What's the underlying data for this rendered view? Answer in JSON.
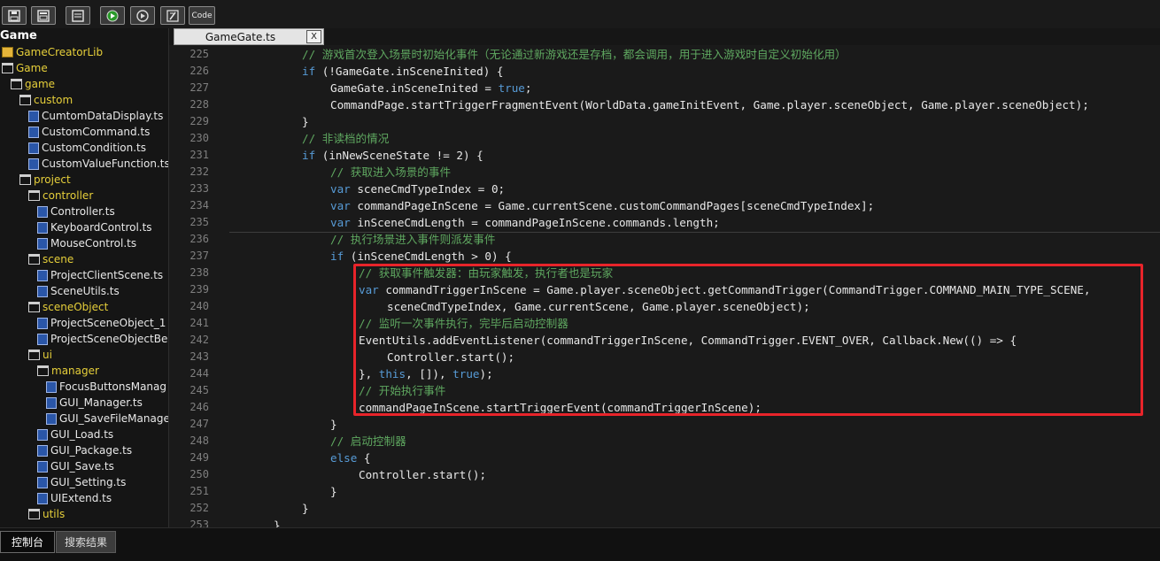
{
  "toolbar": {
    "buttons": [
      {
        "name": "save",
        "icon": "save-icon"
      },
      {
        "name": "save-all",
        "icon": "save-all-icon"
      },
      {
        "name": "layout",
        "icon": "layout-icon"
      },
      {
        "name": "run",
        "icon": "play-icon"
      },
      {
        "name": "run-debug",
        "icon": "play-outline-icon"
      },
      {
        "name": "tool",
        "icon": "tool-icon"
      }
    ],
    "code_label": "Code"
  },
  "sidebar": {
    "title": "Game",
    "items": [
      {
        "label": "GameCreatorLib",
        "type": "lib",
        "level": 0
      },
      {
        "label": "Game",
        "type": "folder",
        "level": 0
      },
      {
        "label": "game",
        "type": "folder",
        "level": 1
      },
      {
        "label": "custom",
        "type": "folder",
        "level": 2
      },
      {
        "label": "CumtomDataDisplay.ts",
        "type": "file",
        "level": 3
      },
      {
        "label": "CustomCommand.ts",
        "type": "file",
        "level": 3
      },
      {
        "label": "CustomCondition.ts",
        "type": "file",
        "level": 3
      },
      {
        "label": "CustomValueFunction.ts",
        "type": "file",
        "level": 3
      },
      {
        "label": "project",
        "type": "folder",
        "level": 2
      },
      {
        "label": "controller",
        "type": "folder",
        "level": 3
      },
      {
        "label": "Controller.ts",
        "type": "file",
        "level": 4
      },
      {
        "label": "KeyboardControl.ts",
        "type": "file",
        "level": 4
      },
      {
        "label": "MouseControl.ts",
        "type": "file",
        "level": 4
      },
      {
        "label": "scene",
        "type": "folder",
        "level": 3
      },
      {
        "label": "ProjectClientScene.ts",
        "type": "file",
        "level": 4
      },
      {
        "label": "SceneUtils.ts",
        "type": "file",
        "level": 4
      },
      {
        "label": "sceneObject",
        "type": "folder",
        "level": 3
      },
      {
        "label": "ProjectSceneObject_1",
        "type": "file",
        "level": 4
      },
      {
        "label": "ProjectSceneObjectBe",
        "type": "file",
        "level": 4
      },
      {
        "label": "ui",
        "type": "folder",
        "level": 3
      },
      {
        "label": "manager",
        "type": "folder",
        "level": 4
      },
      {
        "label": "FocusButtonsManag",
        "type": "file",
        "level": 5
      },
      {
        "label": "GUI_Manager.ts",
        "type": "file",
        "level": 5
      },
      {
        "label": "GUI_SaveFileManage",
        "type": "file",
        "level": 5
      },
      {
        "label": "GUI_Load.ts",
        "type": "file",
        "level": 4
      },
      {
        "label": "GUI_Package.ts",
        "type": "file",
        "level": 4
      },
      {
        "label": "GUI_Save.ts",
        "type": "file",
        "level": 4
      },
      {
        "label": "GUI_Setting.ts",
        "type": "file",
        "level": 4
      },
      {
        "label": "UIExtend.ts",
        "type": "file",
        "level": 4
      },
      {
        "label": "utils",
        "type": "folder",
        "level": 3
      }
    ]
  },
  "tab": {
    "label": "GameGate.ts",
    "close": "X"
  },
  "editor": {
    "lines": [
      {
        "num": "225",
        "indent": 2,
        "segments": [
          {
            "t": "// 游戏首次登入场景时初始化事件（无论通过新游戏还是存档，都会调用，用于进入游戏时自定义初始化用）",
            "c": "cmt"
          }
        ]
      },
      {
        "num": "226",
        "indent": 2,
        "segments": [
          {
            "t": "if",
            "c": "kw"
          },
          {
            "t": " (!GameGate.inSceneInited) {",
            "c": ""
          }
        ]
      },
      {
        "num": "227",
        "indent": 3,
        "segments": [
          {
            "t": "GameGate.inSceneInited = ",
            "c": ""
          },
          {
            "t": "true",
            "c": "kw"
          },
          {
            "t": ";",
            "c": ""
          }
        ]
      },
      {
        "num": "228",
        "indent": 3,
        "segments": [
          {
            "t": "CommandPage.startTriggerFragmentEvent(WorldData.gameInitEvent, Game.player.sceneObject, Game.player.sceneObject);",
            "c": ""
          }
        ]
      },
      {
        "num": "229",
        "indent": 2,
        "segments": [
          {
            "t": "}",
            "c": ""
          }
        ]
      },
      {
        "num": "230",
        "indent": 2,
        "segments": [
          {
            "t": "// 非读档的情况",
            "c": "cmt"
          }
        ]
      },
      {
        "num": "231",
        "indent": 2,
        "segments": [
          {
            "t": "if",
            "c": "kw"
          },
          {
            "t": " (inNewSceneState != 2) {",
            "c": ""
          }
        ]
      },
      {
        "num": "232",
        "indent": 3,
        "segments": [
          {
            "t": "// 获取进入场景的事件",
            "c": "cmt"
          }
        ]
      },
      {
        "num": "233",
        "indent": 3,
        "segments": [
          {
            "t": "var",
            "c": "kw"
          },
          {
            "t": " sceneCmdTypeIndex = 0;",
            "c": ""
          }
        ]
      },
      {
        "num": "234",
        "indent": 3,
        "segments": [
          {
            "t": "var",
            "c": "kw"
          },
          {
            "t": " commandPageInScene = Game.currentScene.customCommandPages[sceneCmdTypeIndex];",
            "c": ""
          }
        ]
      },
      {
        "num": "235",
        "indent": 3,
        "segments": [
          {
            "t": "var",
            "c": "kw"
          },
          {
            "t": " inSceneCmdLength = commandPageInScene.commands.length;",
            "c": ""
          }
        ]
      },
      {
        "num": "236",
        "indent": 3,
        "segments": [
          {
            "t": "// 执行场景进入事件则派发事件",
            "c": "cmt"
          }
        ]
      },
      {
        "num": "237",
        "indent": 3,
        "segments": [
          {
            "t": "if",
            "c": "kw"
          },
          {
            "t": " (inSceneCmdLength > 0) {",
            "c": ""
          }
        ]
      },
      {
        "num": "238",
        "indent": 4,
        "segments": [
          {
            "t": "// 获取事件触发器：由玩家触发，执行者也是玩家",
            "c": "cmt"
          }
        ]
      },
      {
        "num": "239",
        "indent": 4,
        "segments": [
          {
            "t": "var",
            "c": "kw"
          },
          {
            "t": " commandTriggerInScene = Game.player.sceneObject.getCommandTrigger(CommandTrigger.COMMAND_MAIN_TYPE_SCENE,",
            "c": ""
          }
        ]
      },
      {
        "num": "240",
        "indent": 5,
        "segments": [
          {
            "t": "sceneCmdTypeIndex, Game.currentScene, Game.player.sceneObject);",
            "c": ""
          }
        ]
      },
      {
        "num": "241",
        "indent": 4,
        "segments": [
          {
            "t": "// 监听一次事件执行，完毕后启动控制器",
            "c": "cmt"
          }
        ]
      },
      {
        "num": "242",
        "indent": 4,
        "segments": [
          {
            "t": "EventUtils.addEventListener(commandTriggerInScene, CommandTrigger.EVENT_OVER, Callback.New(() => {",
            "c": ""
          }
        ]
      },
      {
        "num": "243",
        "indent": 5,
        "segments": [
          {
            "t": "Controller.start();",
            "c": ""
          }
        ]
      },
      {
        "num": "244",
        "indent": 4,
        "segments": [
          {
            "t": "}, ",
            "c": ""
          },
          {
            "t": "this",
            "c": "kw"
          },
          {
            "t": ", []), ",
            "c": ""
          },
          {
            "t": "true",
            "c": "kw"
          },
          {
            "t": ");",
            "c": ""
          }
        ]
      },
      {
        "num": "245",
        "indent": 4,
        "segments": [
          {
            "t": "// 开始执行事件",
            "c": "cmt"
          }
        ]
      },
      {
        "num": "246",
        "indent": 4,
        "segments": [
          {
            "t": "commandPageInScene.startTriggerEvent(commandTriggerInScene);",
            "c": ""
          }
        ]
      },
      {
        "num": "247",
        "indent": 3,
        "segments": [
          {
            "t": "}",
            "c": ""
          }
        ]
      },
      {
        "num": "248",
        "indent": 3,
        "segments": [
          {
            "t": "// 启动控制器",
            "c": "cmt"
          }
        ]
      },
      {
        "num": "249",
        "indent": 3,
        "segments": [
          {
            "t": "else",
            "c": "kw"
          },
          {
            "t": " {",
            "c": ""
          }
        ]
      },
      {
        "num": "250",
        "indent": 4,
        "segments": [
          {
            "t": "Controller.start();",
            "c": ""
          }
        ]
      },
      {
        "num": "251",
        "indent": 3,
        "segments": [
          {
            "t": "}",
            "c": ""
          }
        ]
      },
      {
        "num": "252",
        "indent": 2,
        "segments": [
          {
            "t": "}",
            "c": ""
          }
        ]
      },
      {
        "num": "253",
        "indent": 1,
        "segments": [
          {
            "t": "}",
            "c": ""
          }
        ]
      }
    ]
  },
  "bottom_tabs": {
    "console": "控制台",
    "search_results": "搜索结果"
  },
  "colors": {
    "keyword": "#579bd6",
    "comment": "#5fa860",
    "folder_text": "#e6cf3a",
    "highlight_border": "#e8242a"
  }
}
